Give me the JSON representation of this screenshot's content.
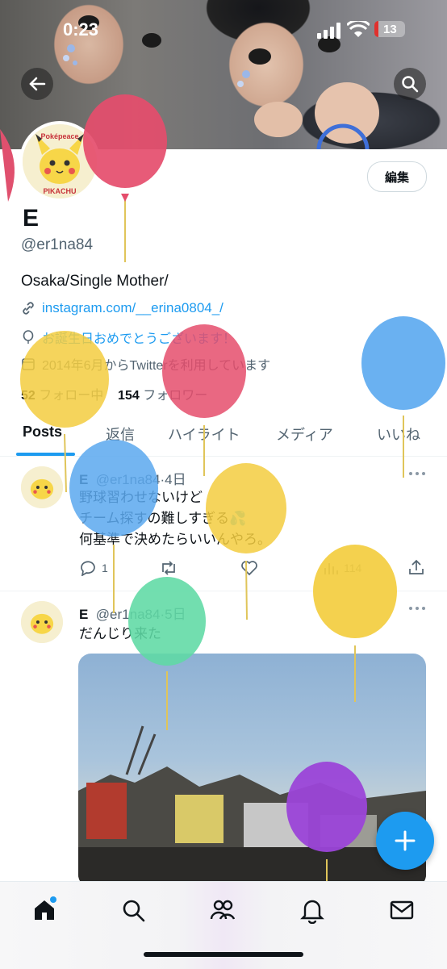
{
  "status_bar": {
    "time": "0:23",
    "battery": "13"
  },
  "profile": {
    "name": "E",
    "handle": "@er1na84",
    "bio": "Osaka/Single Mother/",
    "link": "instagram.com/__erina0804_/",
    "birthday": "お誕生日おめでとうございます！",
    "joined": "2014年6月からTwitterを利用しています",
    "following_count": "52",
    "following_label": "フォロー中",
    "followers_count": "154",
    "followers_label": "フォロワー",
    "edit_label": "編集",
    "avatar_text_top": "Poképeace",
    "avatar_text_bottom": "PIKACHU"
  },
  "tabs": [
    "Posts",
    "返信",
    "ハイライト",
    "メディア",
    "いいね"
  ],
  "posts": [
    {
      "name": "E",
      "handle": "@er1na84",
      "time": "4日",
      "text": "野球習わせないけど\nチーム探すの難しすぎる💦\n何基準で決めたらいいんやろ。",
      "replies": "1",
      "views": "114"
    },
    {
      "name": "E",
      "handle": "@er1na84",
      "time": "5日",
      "text": "だんじり来た"
    }
  ],
  "colors": {
    "accent": "#1d9bf0",
    "text": "#0f1419",
    "muted": "#536471"
  },
  "icons": [
    "back-arrow-icon",
    "search-icon",
    "link-icon",
    "balloon-icon",
    "calendar-icon",
    "reply-icon",
    "retweet-icon",
    "like-icon",
    "views-icon",
    "share-icon",
    "more-icon",
    "plus-icon",
    "home-icon",
    "explore-icon",
    "communities-icon",
    "bell-icon",
    "mail-icon"
  ]
}
